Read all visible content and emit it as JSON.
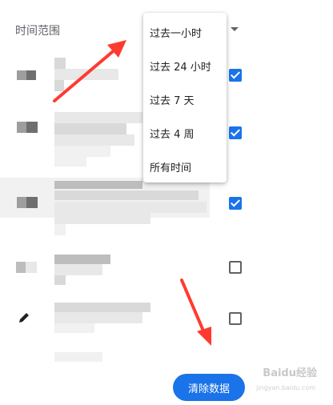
{
  "header": {
    "range_label": "时间范围"
  },
  "menu": {
    "items": [
      "过去一小时",
      "过去 24 小时",
      "过去 7 天",
      "过去 4 周",
      "所有时间"
    ]
  },
  "rows": [
    {
      "checked": true
    },
    {
      "checked": true
    },
    {
      "checked": true
    },
    {
      "checked": false
    },
    {
      "checked": false
    }
  ],
  "footer": {
    "clear_label": "清除数据"
  },
  "watermark": {
    "brand": "Baidu经验",
    "url": "jingyan.baidu.com"
  },
  "colors": {
    "accent": "#1a73e8",
    "arrow": "#ff3b30"
  },
  "icons": [
    "caret-down-icon",
    "checkbox-checked-icon",
    "checkbox-empty-icon",
    "pencil-icon",
    "red-arrow-icon"
  ]
}
